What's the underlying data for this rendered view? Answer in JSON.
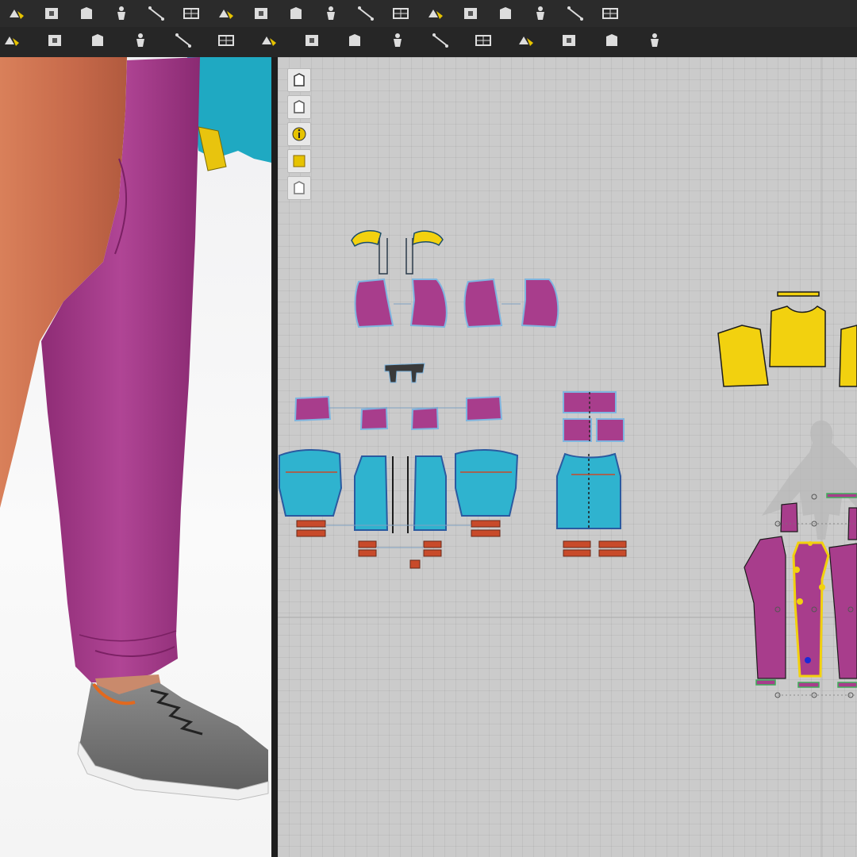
{
  "toolbar_top": {
    "items": [
      {
        "name": "export-icon"
      },
      {
        "name": "garment-front-icon"
      },
      {
        "name": "garment-back-icon"
      },
      {
        "name": "avatar-icon"
      },
      {
        "name": "avatar-pose-icon"
      },
      {
        "name": "measure-tape-icon"
      },
      {
        "name": "ruler-icon"
      },
      {
        "name": "collapse-icon"
      },
      {
        "name": "edit-pattern-icon"
      },
      {
        "name": "transform-pattern-icon"
      },
      {
        "name": "edit-point-icon"
      },
      {
        "name": "polygon-icon"
      },
      {
        "name": "rectangle-icon"
      },
      {
        "name": "internal-shape-icon"
      },
      {
        "name": "segment-sewing-icon"
      },
      {
        "name": "avatar-arrange-icon"
      },
      {
        "name": "grid-select-icon"
      },
      {
        "name": "grid-icon"
      }
    ]
  },
  "toolbar_bottom": {
    "items": [
      {
        "name": "hanger-icon"
      },
      {
        "name": "zipper-icon"
      },
      {
        "name": "fold-icon"
      },
      {
        "name": "strip-icon"
      },
      {
        "name": "gather-icon"
      },
      {
        "name": "pin-icon"
      },
      {
        "name": "tack-icon"
      },
      {
        "name": "arrangement-icon"
      },
      {
        "name": "symmetry-icon"
      },
      {
        "name": "iron-icon"
      },
      {
        "name": "shirt-icon"
      },
      {
        "name": "sew-icon"
      },
      {
        "name": "fabric-icon"
      },
      {
        "name": "fabric-pattern-icon"
      },
      {
        "name": "line-icon"
      },
      {
        "name": "dashed-line-icon"
      }
    ]
  },
  "side_tools": [
    {
      "name": "brush-tool-icon"
    },
    {
      "name": "show-garment-icon"
    },
    {
      "name": "info-icon"
    },
    {
      "name": "texture-icon"
    },
    {
      "name": "lock-garment-icon"
    }
  ],
  "colors": {
    "magenta": "#a83d8c",
    "cyan": "#2fb3cf",
    "yellow": "#f2d10f",
    "orange_red": "#c84a2a",
    "background_2d": "#cbcbcb",
    "toolbar": "#2b2b2b"
  }
}
